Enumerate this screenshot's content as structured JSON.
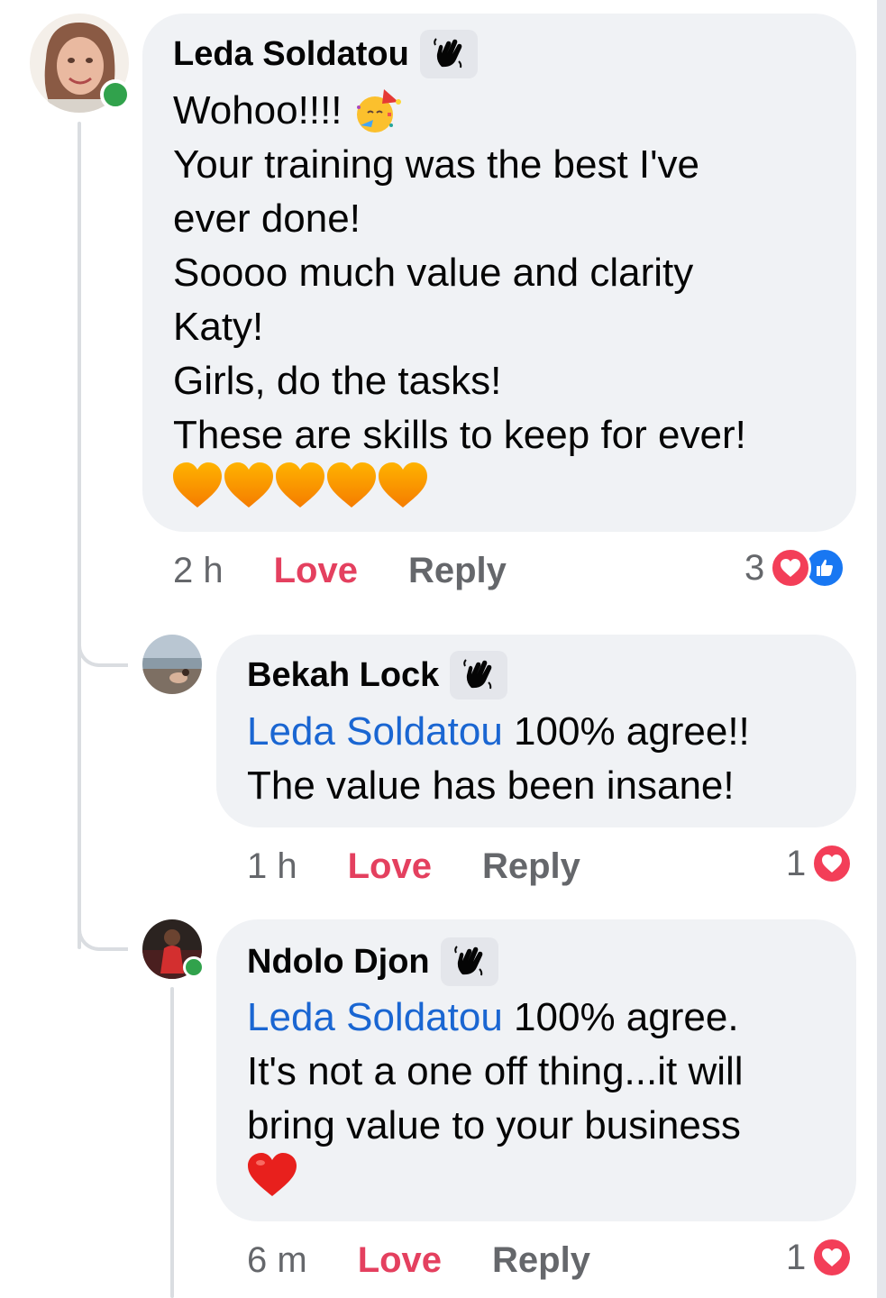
{
  "comments": [
    {
      "author": "Leda Soldatou",
      "lines": [
        "Wohoo!!!!",
        "Your training was the best I've",
        "ever done!",
        "Soooo much value and clarity",
        "Katy!",
        "Girls, do the tasks!",
        "These are skills to keep for ever!"
      ],
      "time": "2 h",
      "love_label": "Love",
      "reply_label": "Reply",
      "reaction_count": "3"
    },
    {
      "author": "Bekah Lock",
      "mention": "Leda Soldatou",
      "line1_rest": " 100% agree!!",
      "line2": "The value has been insane!",
      "time": "1 h",
      "love_label": "Love",
      "reply_label": "Reply",
      "reaction_count": "1"
    },
    {
      "author": "Ndolo Djon",
      "mention": "Leda Soldatou",
      "line1_rest": " 100% agree.",
      "line2": "It's not a one off thing...it will",
      "line3": "bring value to  your business",
      "time": "6 m",
      "love_label": "Love",
      "reply_label": "Reply",
      "reaction_count": "1"
    }
  ],
  "colors": {
    "bubble": "#f0f2f5",
    "love": "#e4405f",
    "mention": "#1a66d2",
    "online": "#31a24c",
    "like": "#1877f2"
  },
  "icons": [
    "wave-hand-icon",
    "party-face-emoji",
    "orange-heart-emoji",
    "red-heart-emoji",
    "love-reaction-icon",
    "like-reaction-icon"
  ]
}
